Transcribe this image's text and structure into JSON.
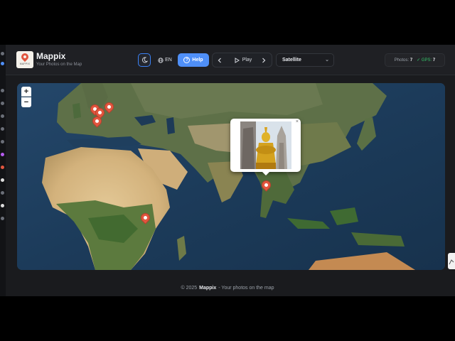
{
  "app": {
    "name": "Mappix",
    "tagline": "Your Photos on the Map",
    "logo_text": "MAPPIX"
  },
  "header": {
    "theme_toggle_icon": "moon-icon",
    "language": {
      "icon": "globe-icon",
      "label": "EN"
    },
    "help": {
      "icon": "question-circle-icon",
      "label": "Help"
    },
    "player": {
      "prev_icon": "chevron-left-icon",
      "play_label": "Play",
      "play_icon": "play-icon",
      "next_icon": "chevron-right-icon"
    },
    "map_style": {
      "selected": "Satellite",
      "chevron": "⌄"
    },
    "stats": {
      "photos_label": "Photos:",
      "photos_count": "7",
      "gps_check": "✓",
      "gps_label": "GPS:",
      "gps_count": "7"
    }
  },
  "map": {
    "zoom_in": "+",
    "zoom_out": "−",
    "markers": [
      {
        "name": "marker-europe-1"
      },
      {
        "name": "marker-europe-2"
      },
      {
        "name": "marker-europe-3"
      },
      {
        "name": "marker-europe-4"
      },
      {
        "name": "marker-thailand"
      },
      {
        "name": "marker-kenya"
      }
    ],
    "popup": {
      "close": "×"
    }
  },
  "footer": {
    "prefix": "© 2025",
    "brand": "Mappix",
    "suffix": "- Your photos on the map"
  },
  "colors": {
    "accent": "#4f8ff7",
    "marker": "#e2563f",
    "gps_ok": "#35c46a",
    "background": "#1a1b1e"
  }
}
